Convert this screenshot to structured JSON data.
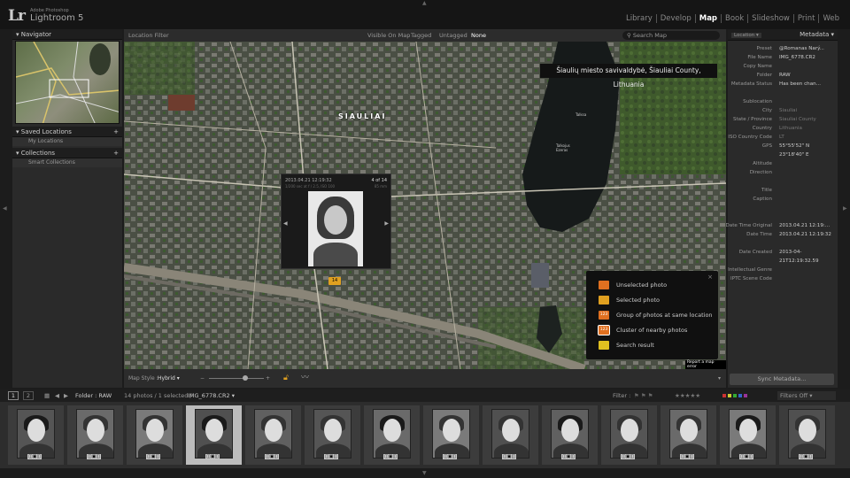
{
  "app": {
    "logo": "Lr",
    "brand_small": "Adobe Photoshop",
    "brand_name": "Lightroom 5"
  },
  "modules": [
    "Library",
    "Develop",
    "Map",
    "Book",
    "Slideshow",
    "Print",
    "Web"
  ],
  "active_module": "Map",
  "left_panel": {
    "navigator_title": "Navigator",
    "saved_locations_title": "Saved Locations",
    "saved_locations_items": [
      "My Locations"
    ],
    "collections_title": "Collections",
    "collections_items": [
      "Smart Collections"
    ]
  },
  "filter_bar": {
    "title": "Location Filter",
    "options": [
      "Visible On Map",
      "Tagged",
      "Untagged",
      "None"
    ],
    "active_option": "None",
    "search_label": "Search Map"
  },
  "map": {
    "city_label": "SIAULIAI",
    "location_tooltip": "Šiaulių miesto savivaldybė, Šiauliai County, Lithuania",
    "lake_labels": [
      "Talksa",
      "Talkojus Ezeras"
    ],
    "marker_label": "14",
    "footer": "Report a map error"
  },
  "popup": {
    "date": "2013.04.21 12:19:32",
    "count": "4 of 14",
    "settings": "1/200 sec at f / 2.5, ISO 100",
    "focal": "85 mm"
  },
  "legend": {
    "items": [
      {
        "label": "Unselected photo",
        "icon": "unselected-pin",
        "color": "#e07020",
        "text": ""
      },
      {
        "label": "Selected photo",
        "icon": "selected-pin",
        "color": "#e0a020",
        "text": ""
      },
      {
        "label": "Group of photos at same location",
        "icon": "group-badge",
        "color": "#e07020",
        "text": "123"
      },
      {
        "label": "Cluster of nearby photos",
        "icon": "cluster-badge",
        "color": "#e07020",
        "text": "123"
      },
      {
        "label": "Search result",
        "icon": "search-pin",
        "color": "#e0c020",
        "text": ""
      }
    ]
  },
  "map_bar": {
    "style_label": "Map Style :",
    "style_value": "Hybrid"
  },
  "right_panel": {
    "location_dropdown": "Location",
    "metadata_title": "Metadata",
    "rows": [
      {
        "label": "Preset",
        "value": "@Romanas Narý...",
        "dim": false
      },
      {
        "label": "File Name",
        "value": "IMG_6778.CR2",
        "dim": false
      },
      {
        "label": "Copy Name",
        "value": "",
        "dim": false
      },
      {
        "label": "Folder",
        "value": "RAW",
        "dim": false
      },
      {
        "label": "Metadata Status",
        "value": "Has been chan...",
        "dim": false
      },
      {
        "label": "",
        "value": "",
        "dim": false
      },
      {
        "label": "Sublocation",
        "value": "",
        "dim": false
      },
      {
        "label": "City",
        "value": "Siauliai",
        "dim": true
      },
      {
        "label": "State / Province",
        "value": "Siauliai County",
        "dim": true
      },
      {
        "label": "Country",
        "value": "Lithuania",
        "dim": true
      },
      {
        "label": "ISO Country Code",
        "value": "LT",
        "dim": true
      },
      {
        "label": "GPS",
        "value": "55°55'52\" N",
        "dim": false
      },
      {
        "label": "",
        "value": "23°18'40\" E",
        "dim": false
      },
      {
        "label": "Altitude",
        "value": "",
        "dim": false
      },
      {
        "label": "Direction",
        "value": "",
        "dim": false
      },
      {
        "label": "",
        "value": "",
        "dim": false
      },
      {
        "label": "Title",
        "value": "",
        "dim": false
      },
      {
        "label": "Caption",
        "value": "",
        "dim": false
      },
      {
        "label": "",
        "value": "",
        "dim": false
      },
      {
        "label": "",
        "value": "",
        "dim": false
      },
      {
        "label": "Date Time Original",
        "value": "2013.04.21 12:19:...",
        "dim": false
      },
      {
        "label": "Date Time",
        "value": "2013.04.21 12:19:32",
        "dim": false
      },
      {
        "label": "",
        "value": "",
        "dim": false
      },
      {
        "label": "Date Created",
        "value": "2013-04-",
        "dim": false
      },
      {
        "label": "",
        "value": "21T12:19:32.59",
        "dim": false
      },
      {
        "label": "Intellectual Genre",
        "value": "",
        "dim": false
      },
      {
        "label": "IPTC Scene Code",
        "value": "",
        "dim": false
      }
    ],
    "sync_button": "Sync Metadata..."
  },
  "filmstrip_bar": {
    "page1": "1",
    "page2": "2",
    "folder": "Folder : RAW",
    "info": "14 photos / 1 selected /",
    "selected_file": "IMG_6778.CR2",
    "filter_label": "Filter :",
    "filter_value": "Filters Off"
  },
  "filmstrip": {
    "selected_index": 3,
    "count": 14
  }
}
